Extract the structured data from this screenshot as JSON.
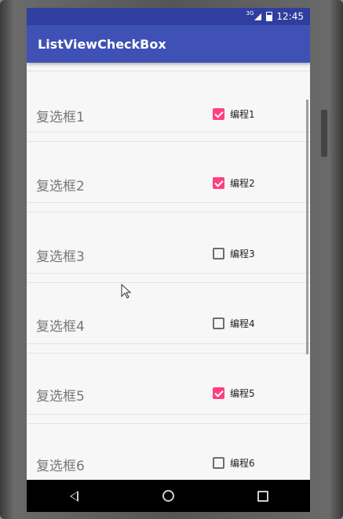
{
  "status_bar": {
    "network": "3G",
    "time": "12:45"
  },
  "app_bar": {
    "title": "ListViewCheckBox"
  },
  "items": [
    {
      "label": "复选框1",
      "checkbox_label": "编程1",
      "checked": true
    },
    {
      "label": "复选框2",
      "checkbox_label": "编程2",
      "checked": true
    },
    {
      "label": "复选框3",
      "checkbox_label": "编程3",
      "checked": false
    },
    {
      "label": "复选框4",
      "checkbox_label": "编程4",
      "checked": false
    },
    {
      "label": "复选框5",
      "checkbox_label": "编程5",
      "checked": true
    },
    {
      "label": "复选框6",
      "checkbox_label": "编程6",
      "checked": false
    }
  ],
  "colors": {
    "status_bar": "#303f9f",
    "app_bar": "#3f51b5",
    "accent": "#ff4081"
  },
  "icons": {
    "back": "back-icon",
    "home": "home-icon",
    "recents": "recents-icon"
  }
}
